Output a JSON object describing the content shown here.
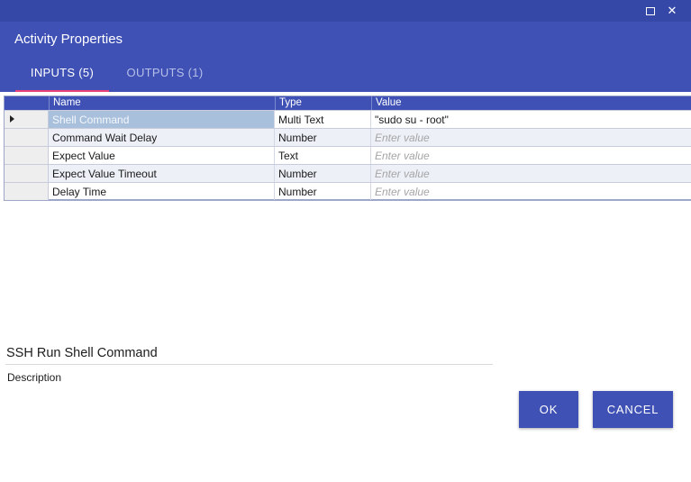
{
  "window": {
    "maximize_icon": "maximize-icon",
    "close_icon": "close-icon",
    "close_glyph": "✕"
  },
  "dialog": {
    "title": "Activity Properties",
    "tabs": [
      {
        "label": "INPUTS (5)",
        "active": true
      },
      {
        "label": "OUTPUTS (1)",
        "active": false
      }
    ],
    "accent_color": "#3f51b5",
    "tab_indicator_color": "#e9407a"
  },
  "grid": {
    "columns": [
      "Name",
      "Type",
      "Value"
    ],
    "rows": [
      {
        "name": "Shell Command",
        "type": "Multi Text",
        "value": "\"sudo su - root\"",
        "placeholder": ""
      },
      {
        "name": "Command Wait Delay",
        "type": "Number",
        "value": "",
        "placeholder": "Enter value"
      },
      {
        "name": "Expect Value",
        "type": "Text",
        "value": "",
        "placeholder": "Enter value"
      },
      {
        "name": "Expect Value Timeout",
        "type": "Number",
        "value": "",
        "placeholder": "Enter value"
      },
      {
        "name": "Delay Time",
        "type": "Number",
        "value": "",
        "placeholder": "Enter value"
      }
    ]
  },
  "activity": {
    "name": "SSH Run Shell Command",
    "description_label": "Description"
  },
  "buttons": {
    "ok": "OK",
    "cancel": "CANCEL"
  }
}
